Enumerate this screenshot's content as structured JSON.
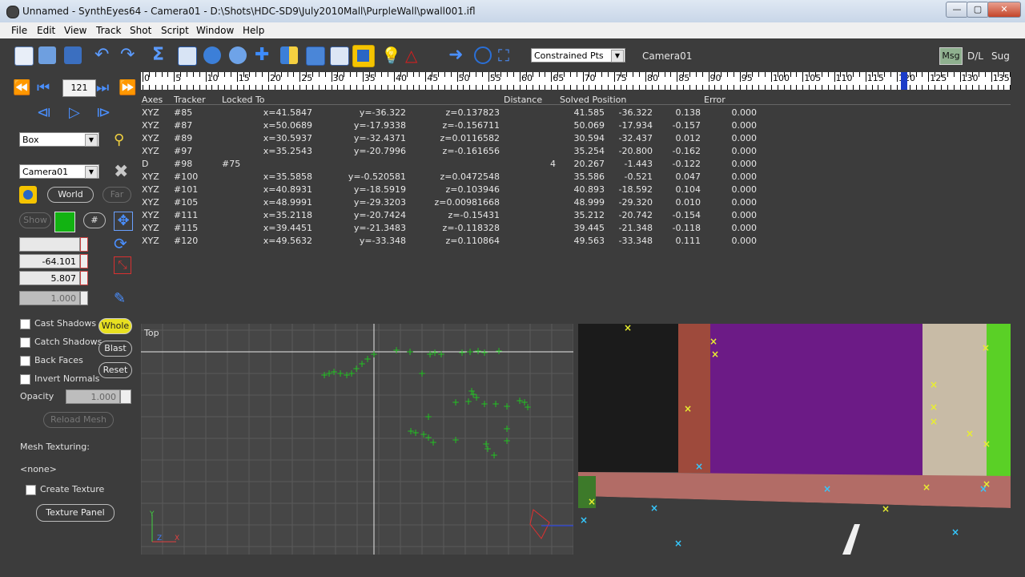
{
  "window": {
    "title": "Unnamed - SynthEyes64 - Camera01 - D:\\Shots\\HDC-SD9\\July2010Mall\\PurpleWall\\pwall001.ifl",
    "minimize": "—",
    "maximize": "▢",
    "close": "✕"
  },
  "menu": [
    "File",
    "Edit",
    "View",
    "Track",
    "Shot",
    "Script",
    "Window",
    "Help"
  ],
  "toolbar": {
    "mode_select": "Constrained Pts",
    "camera_label": "Camera01",
    "msg": "Msg",
    "dl": "D/L",
    "sug": "Sug"
  },
  "playback": {
    "frame": "121"
  },
  "ruler": {
    "labels": [
      "0",
      "5",
      "10",
      "15",
      "20",
      "25",
      "30",
      "35",
      "40",
      "45",
      "50",
      "55",
      "60",
      "65",
      "70",
      "75",
      "80",
      "85",
      "90",
      "95",
      "100",
      "105",
      "110",
      "115",
      "120",
      "125",
      "130",
      "135"
    ],
    "current_frame": 121
  },
  "table": {
    "headers": {
      "axes": "Axes",
      "tracker": "Tracker",
      "locked_to": "Locked To",
      "distance": "Distance",
      "solved_position": "Solved Position",
      "error": "Error"
    },
    "rows": [
      {
        "axes": "XYZ",
        "tracker": "#85",
        "locked": "",
        "x": "x=41.5847",
        "y": "y=-36.322",
        "z": "z=0.137823",
        "dist": "",
        "sx": "41.585",
        "sy": "-36.322",
        "sz": "0.138",
        "err": "0.000"
      },
      {
        "axes": "XYZ",
        "tracker": "#87",
        "locked": "",
        "x": "x=50.0689",
        "y": "y=-17.9338",
        "z": "z=-0.156711",
        "dist": "",
        "sx": "50.069",
        "sy": "-17.934",
        "sz": "-0.157",
        "err": "0.000"
      },
      {
        "axes": "XYZ",
        "tracker": "#89",
        "locked": "",
        "x": "x=30.5937",
        "y": "y=-32.4371",
        "z": "z=0.0116582",
        "dist": "",
        "sx": "30.594",
        "sy": "-32.437",
        "sz": "0.012",
        "err": "0.000"
      },
      {
        "axes": "XYZ",
        "tracker": "#97",
        "locked": "",
        "x": "x=35.2543",
        "y": "y=-20.7996",
        "z": "z=-0.161656",
        "dist": "",
        "sx": "35.254",
        "sy": "-20.800",
        "sz": "-0.162",
        "err": "0.000"
      },
      {
        "axes": "D",
        "tracker": "#98",
        "locked": "#75",
        "x": "",
        "y": "",
        "z": "",
        "dist": "4",
        "sx": "20.267",
        "sy": "-1.443",
        "sz": "-0.122",
        "err": "0.000"
      },
      {
        "axes": "XYZ",
        "tracker": "#100",
        "locked": "",
        "x": "x=35.5858",
        "y": "y=-0.520581",
        "z": "z=0.0472548",
        "dist": "",
        "sx": "35.586",
        "sy": "-0.521",
        "sz": "0.047",
        "err": "0.000"
      },
      {
        "axes": "XYZ",
        "tracker": "#101",
        "locked": "",
        "x": "x=40.8931",
        "y": "y=-18.5919",
        "z": "z=0.103946",
        "dist": "",
        "sx": "40.893",
        "sy": "-18.592",
        "sz": "0.104",
        "err": "0.000"
      },
      {
        "axes": "XYZ",
        "tracker": "#105",
        "locked": "",
        "x": "x=48.9991",
        "y": "y=-29.3203",
        "z": "z=0.00981668",
        "dist": "",
        "sx": "48.999",
        "sy": "-29.320",
        "sz": "0.010",
        "err": "0.000"
      },
      {
        "axes": "XYZ",
        "tracker": "#111",
        "locked": "",
        "x": "x=35.2118",
        "y": "y=-20.7424",
        "z": "z=-0.15431",
        "dist": "",
        "sx": "35.212",
        "sy": "-20.742",
        "sz": "-0.154",
        "err": "0.000"
      },
      {
        "axes": "XYZ",
        "tracker": "#115",
        "locked": "",
        "x": "x=39.4451",
        "y": "y=-21.3483",
        "z": "z=-0.118328",
        "dist": "",
        "sx": "39.445",
        "sy": "-21.348",
        "sz": "-0.118",
        "err": "0.000"
      },
      {
        "axes": "XYZ",
        "tracker": "#120",
        "locked": "",
        "x": "x=49.5632",
        "y": "y=-33.348",
        "z": "z=0.110864",
        "dist": "",
        "sx": "49.563",
        "sy": "-33.348",
        "sz": "0.111",
        "err": "0.000"
      }
    ]
  },
  "left_panel": {
    "mesh_type": "Box",
    "object": "Camera01",
    "world": "World",
    "far": "Far",
    "show": "Show",
    "hash": "#",
    "field1": "",
    "field2": "-64.101",
    "field3": "5.807",
    "field4": "1.000",
    "cast_shadows": "Cast Shadows",
    "catch_shadows": "Catch Shadows",
    "back_faces": "Back Faces",
    "invert_normals": "Invert Normals",
    "whole": "Whole",
    "blast": "Blast",
    "reset": "Reset",
    "opacity_label": "Opacity",
    "opacity_value": "1.000",
    "reload_mesh": "Reload Mesh",
    "mesh_texturing": "Mesh Texturing:",
    "none": "<none>",
    "create_texture": "Create Texture",
    "texture_panel": "Texture Panel",
    "swatch_color": "#12b312"
  },
  "viewports": {
    "top_label": "Top"
  }
}
